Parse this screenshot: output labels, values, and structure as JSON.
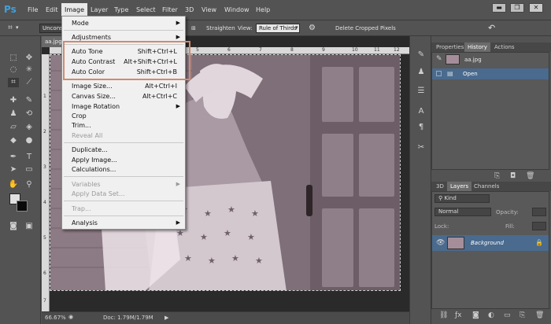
{
  "app": {
    "logo": "Ps"
  },
  "menubar": {
    "items": [
      "File",
      "Edit",
      "Image",
      "Layer",
      "Type",
      "Select",
      "Filter",
      "3D",
      "View",
      "Window",
      "Help"
    ],
    "window_buttons": {
      "minimize": "▬",
      "maximize": "❐",
      "close": "✕"
    }
  },
  "options": {
    "preset": "Unconst",
    "straighten": "Straighten",
    "view_label": "View:",
    "view_value": "Rule of Thirds",
    "delete_cropped": "Delete Cropped Pixels",
    "delete_cropped_checked": true
  },
  "document": {
    "tab": "aa.jpg",
    "ruler_top_ticks": [
      "5",
      "6",
      "7",
      "8",
      "9",
      "10",
      "11",
      "12"
    ],
    "ruler_left_ticks": [
      "1",
      "2",
      "3",
      "4",
      "5",
      "6",
      "7"
    ]
  },
  "image_menu": {
    "items": [
      {
        "label": "Mode",
        "shortcut": "",
        "submenu": true,
        "disabled": false
      },
      {
        "label": "Adjustments",
        "shortcut": "",
        "submenu": true,
        "disabled": false
      },
      {
        "label": "Auto Tone",
        "shortcut": "Shift+Ctrl+L",
        "submenu": false,
        "disabled": false
      },
      {
        "label": "Auto Contrast",
        "shortcut": "Alt+Shift+Ctrl+L",
        "submenu": false,
        "disabled": false
      },
      {
        "label": "Auto Color",
        "shortcut": "Shift+Ctrl+B",
        "submenu": false,
        "disabled": false
      },
      {
        "label": "Image Size...",
        "shortcut": "Alt+Ctrl+I",
        "submenu": false,
        "disabled": false
      },
      {
        "label": "Canvas Size...",
        "shortcut": "Alt+Ctrl+C",
        "submenu": false,
        "disabled": false
      },
      {
        "label": "Image Rotation",
        "shortcut": "",
        "submenu": true,
        "disabled": false
      },
      {
        "label": "Crop",
        "shortcut": "",
        "submenu": false,
        "disabled": false
      },
      {
        "label": "Trim...",
        "shortcut": "",
        "submenu": false,
        "disabled": false
      },
      {
        "label": "Reveal All",
        "shortcut": "",
        "submenu": false,
        "disabled": true
      },
      {
        "label": "Duplicate...",
        "shortcut": "",
        "submenu": false,
        "disabled": false
      },
      {
        "label": "Apply Image...",
        "shortcut": "",
        "submenu": false,
        "disabled": false
      },
      {
        "label": "Calculations...",
        "shortcut": "",
        "submenu": false,
        "disabled": false
      },
      {
        "label": "Variables",
        "shortcut": "",
        "submenu": true,
        "disabled": true
      },
      {
        "label": "Apply Data Set...",
        "shortcut": "",
        "submenu": false,
        "disabled": true
      },
      {
        "label": "Trap...",
        "shortcut": "",
        "submenu": false,
        "disabled": true
      },
      {
        "label": "Analysis",
        "shortcut": "",
        "submenu": true,
        "disabled": false
      }
    ]
  },
  "status": {
    "zoom": "66.67%",
    "doc": "Doc: 1.79M/1.79M"
  },
  "properties_panel": {
    "tabs": [
      "Properties",
      "History",
      "Actions"
    ],
    "active_tab": "History",
    "snapshot": "aa.jpg",
    "history_item": "Open"
  },
  "layers_panel": {
    "tabs": [
      "3D",
      "Layers",
      "Channels"
    ],
    "active_tab": "Layers",
    "kind": "Kind",
    "blend_mode": "Normal",
    "opacity_label": "Opacity:",
    "lock_label": "Lock:",
    "fill_label": "Fill:",
    "layer_name": "Background"
  },
  "icons": {
    "crop": "crop-icon",
    "gear": "gear-icon",
    "reset": "reset-icon",
    "eye": "eye-icon",
    "lock": "lock-icon"
  }
}
